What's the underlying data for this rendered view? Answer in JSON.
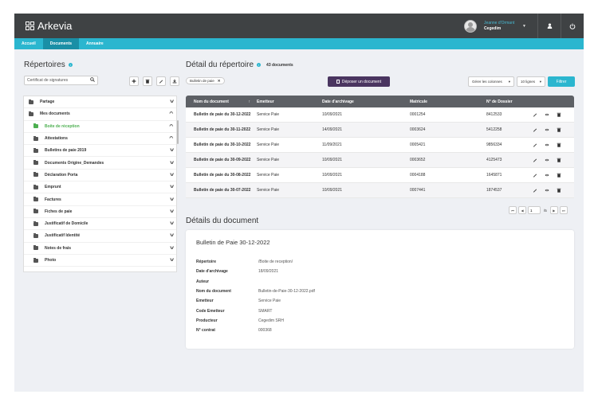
{
  "app": {
    "name": "Arkevia",
    "user_name": "Jeanne d'Ormant",
    "user_company": "Cegedim"
  },
  "nav": [
    "Accueil",
    "Documents",
    "Annuaire"
  ],
  "left": {
    "title": "Répertoires",
    "search_value": "Certificat de signatures",
    "tree": [
      {
        "label": "Partage",
        "chevron": "down"
      },
      {
        "label": "Mes documents",
        "chevron": "up"
      },
      {
        "label": "Boite de réception",
        "chevron": "up",
        "active": true
      },
      {
        "label": "Attestations",
        "chevron": "up"
      },
      {
        "label": "Bulletins de paie 2019",
        "chevron": "down"
      },
      {
        "label": "Documents Origine_Demandes",
        "chevron": "down"
      },
      {
        "label": "Déclaration Porta",
        "chevron": "down"
      },
      {
        "label": "Emprunt",
        "chevron": "down"
      },
      {
        "label": "Factures",
        "chevron": "down"
      },
      {
        "label": "Fiches de paie",
        "chevron": "down"
      },
      {
        "label": "Justificatif de Domicile",
        "chevron": "down"
      },
      {
        "label": "Justificatif Identité",
        "chevron": "down"
      },
      {
        "label": "Notes de frais",
        "chevron": "down"
      },
      {
        "label": "Photo",
        "chevron": "down"
      }
    ]
  },
  "right": {
    "title": "Détail du répertoire",
    "doc_count": "43 documents",
    "filter_chip": "Bulletin de paie",
    "deposit_label": "Déposer un document",
    "columns_select": "Gérer les colonnes",
    "rows_select": "10 lignes",
    "filter_label": "Filtrer",
    "columns": [
      "Nom du document",
      "Emetteur",
      "Date d'archivage",
      "Matricule",
      "N° de Dossier"
    ],
    "rows": [
      [
        "Bulletin de paie du 30-12-2022",
        "Service Paie",
        "10/09/2021",
        "0001254",
        "8412533"
      ],
      [
        "Bulletin de paie du 30-11-2022",
        "Service Paie",
        "14/09/2021",
        "0003624",
        "5412258"
      ],
      [
        "Bulletin de paie du 30-10-2022",
        "Service Paie",
        "11/09/2021",
        "0005421",
        "9856334"
      ],
      [
        "Bulletin de paie du 30-09-2022",
        "Service Paie",
        "10/09/2021",
        "0003652",
        "4125473"
      ],
      [
        "Bulletin de paie du 30-08-2022",
        "Service Paie",
        "10/09/2021",
        "0004188",
        "1645871"
      ],
      [
        "Bulletin de paie du 30-07-2022",
        "Service Paie",
        "10/09/2021",
        "0007441",
        "1874537"
      ]
    ],
    "pager_current": "1",
    "pager_total": "/5"
  },
  "details": {
    "title": "Détails du document",
    "doc_name": "Bulletin de Paie 30-12-2022",
    "props": [
      [
        "Répertoire",
        "/Boite de reception/"
      ],
      [
        "Date d'archivage",
        "18/09/2021"
      ],
      [
        "Auteur",
        ""
      ],
      [
        "Nom du document",
        "Bulletin-de-Paie-30-12-2022.pdf"
      ],
      [
        "Emetteur",
        "Service Paie"
      ],
      [
        "Code Emetteur",
        "SMART"
      ],
      [
        "Producteur",
        "Cegedim SRH"
      ],
      [
        "N° contrat",
        "000368"
      ]
    ]
  },
  "colors": {
    "topbar": "#3f4244",
    "nav": "#2bb6cf",
    "nav_active": "#1a8fa6",
    "deposit_button": "#4a3560",
    "active_folder": "#4caf50",
    "table_header": "#5d6065"
  }
}
